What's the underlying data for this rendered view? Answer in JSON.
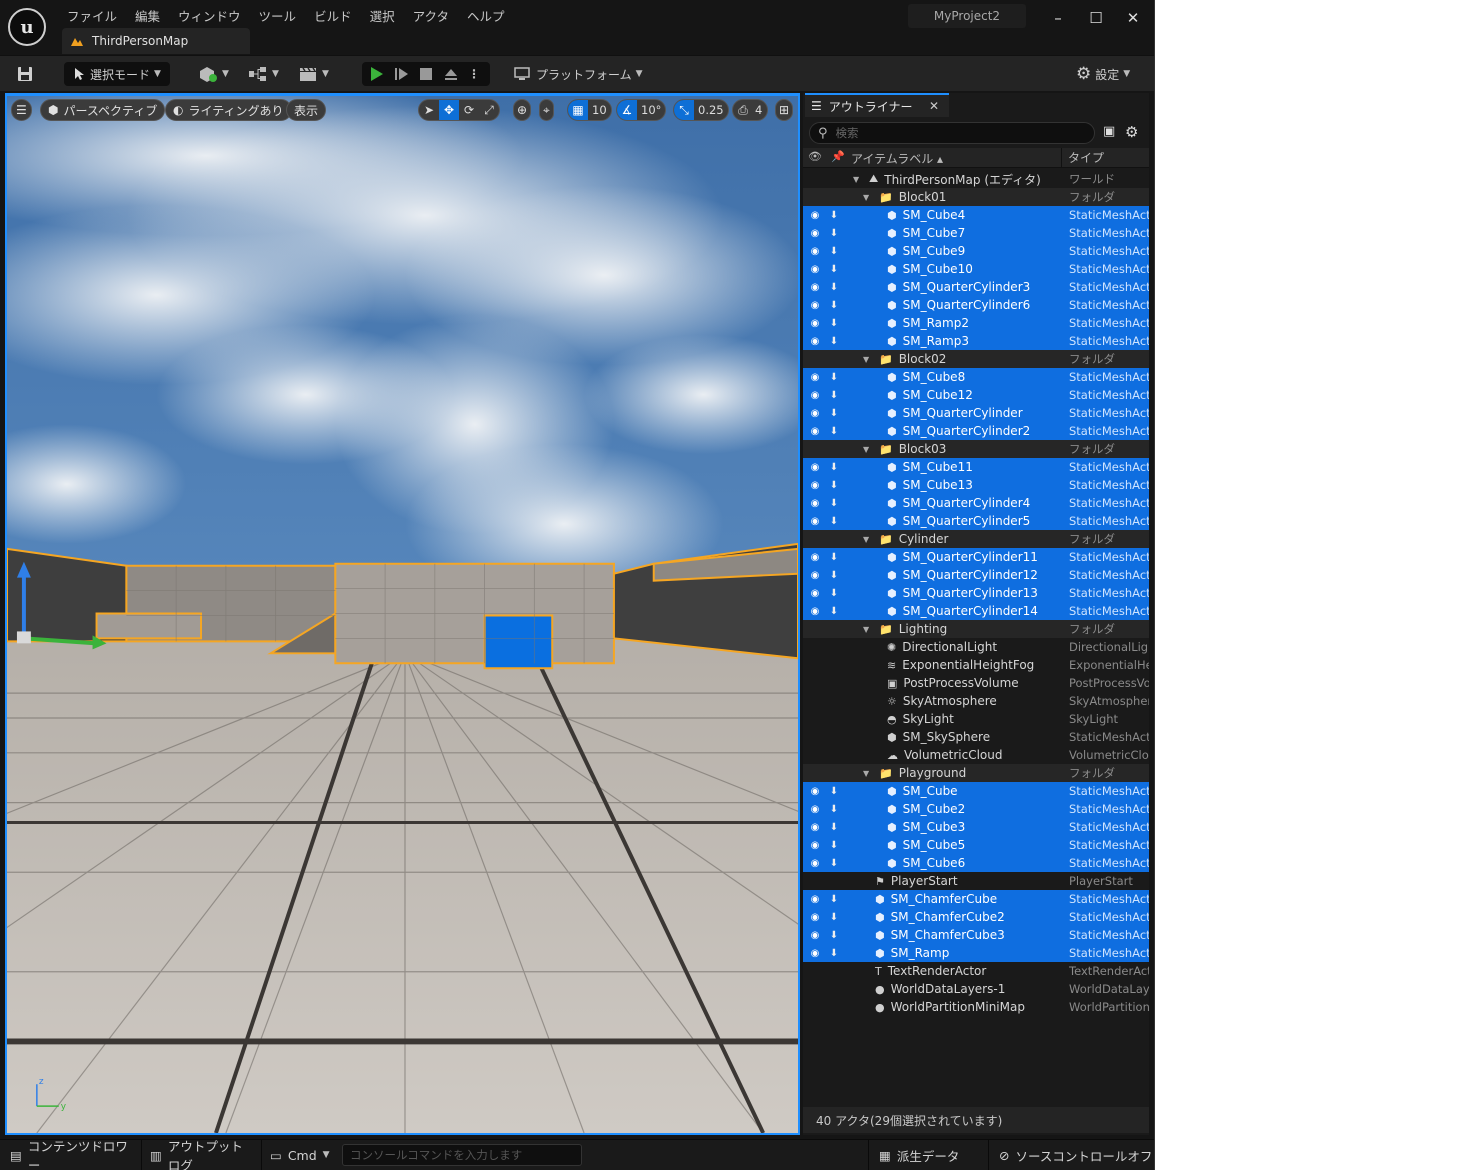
{
  "titlebar": {
    "menu": [
      "ファイル",
      "編集",
      "ウィンドウ",
      "ツール",
      "ビルド",
      "選択",
      "アクタ",
      "ヘルプ"
    ],
    "doc_tab": "ThirdPersonMap",
    "project": "MyProject2"
  },
  "toolbar": {
    "mode": "選択モード",
    "platform": "プラットフォーム",
    "settings": "設定"
  },
  "viewport": {
    "perspective": "パースペクティブ",
    "lighting": "ライティングあり",
    "show": "表示",
    "grid_snap": "10",
    "rot_snap": "10°",
    "scale_snap": "0.25",
    "camera_speed": "4"
  },
  "outliner": {
    "tab": "アウトライナー",
    "search_placeholder": "検索",
    "col_label": "アイテムラベル ▴",
    "col_type": "タイプ",
    "status": "40 アクタ(29個選択されています)",
    "rows": [
      {
        "label": "ThirdPersonMap (エディタ)",
        "type": "ワールド",
        "indent": 0,
        "kind": "world",
        "sel": false,
        "icon": "map-icon"
      },
      {
        "label": "Block01",
        "type": "フォルダ",
        "indent": 1,
        "kind": "folder",
        "sel": false,
        "icon": "folder-icon"
      },
      {
        "label": "SM_Cube4",
        "type": "StaticMeshActor",
        "indent": 2,
        "kind": "item",
        "sel": true,
        "icon": "static-mesh-icon"
      },
      {
        "label": "SM_Cube7",
        "type": "StaticMeshActor",
        "indent": 2,
        "kind": "item",
        "sel": true,
        "icon": "static-mesh-icon"
      },
      {
        "label": "SM_Cube9",
        "type": "StaticMeshActor",
        "indent": 2,
        "kind": "item",
        "sel": true,
        "icon": "static-mesh-icon"
      },
      {
        "label": "SM_Cube10",
        "type": "StaticMeshActor",
        "indent": 2,
        "kind": "item",
        "sel": true,
        "icon": "static-mesh-icon"
      },
      {
        "label": "SM_QuarterCylinder3",
        "type": "StaticMeshActor",
        "indent": 2,
        "kind": "item",
        "sel": true,
        "icon": "static-mesh-icon"
      },
      {
        "label": "SM_QuarterCylinder6",
        "type": "StaticMeshActor",
        "indent": 2,
        "kind": "item",
        "sel": true,
        "icon": "static-mesh-icon"
      },
      {
        "label": "SM_Ramp2",
        "type": "StaticMeshActor",
        "indent": 2,
        "kind": "item",
        "sel": true,
        "icon": "static-mesh-icon"
      },
      {
        "label": "SM_Ramp3",
        "type": "StaticMeshActor",
        "indent": 2,
        "kind": "item",
        "sel": true,
        "icon": "static-mesh-icon"
      },
      {
        "label": "Block02",
        "type": "フォルダ",
        "indent": 1,
        "kind": "folder",
        "sel": false,
        "icon": "folder-icon"
      },
      {
        "label": "SM_Cube8",
        "type": "StaticMeshActor",
        "indent": 2,
        "kind": "item",
        "sel": true,
        "icon": "static-mesh-icon"
      },
      {
        "label": "SM_Cube12",
        "type": "StaticMeshActor",
        "indent": 2,
        "kind": "item",
        "sel": true,
        "icon": "static-mesh-icon"
      },
      {
        "label": "SM_QuarterCylinder",
        "type": "StaticMeshActor",
        "indent": 2,
        "kind": "item",
        "sel": true,
        "icon": "static-mesh-icon"
      },
      {
        "label": "SM_QuarterCylinder2",
        "type": "StaticMeshActor",
        "indent": 2,
        "kind": "item",
        "sel": true,
        "icon": "static-mesh-icon"
      },
      {
        "label": "Block03",
        "type": "フォルダ",
        "indent": 1,
        "kind": "folder",
        "sel": false,
        "icon": "folder-icon"
      },
      {
        "label": "SM_Cube11",
        "type": "StaticMeshActor",
        "indent": 2,
        "kind": "item",
        "sel": true,
        "icon": "static-mesh-icon"
      },
      {
        "label": "SM_Cube13",
        "type": "StaticMeshActor",
        "indent": 2,
        "kind": "item",
        "sel": true,
        "icon": "static-mesh-icon"
      },
      {
        "label": "SM_QuarterCylinder4",
        "type": "StaticMeshActor",
        "indent": 2,
        "kind": "item",
        "sel": true,
        "icon": "static-mesh-icon"
      },
      {
        "label": "SM_QuarterCylinder5",
        "type": "StaticMeshActor",
        "indent": 2,
        "kind": "item",
        "sel": true,
        "icon": "static-mesh-icon"
      },
      {
        "label": "Cylinder",
        "type": "フォルダ",
        "indent": 1,
        "kind": "folder",
        "sel": false,
        "icon": "folder-icon"
      },
      {
        "label": "SM_QuarterCylinder11",
        "type": "StaticMeshActor",
        "indent": 2,
        "kind": "item",
        "sel": true,
        "icon": "static-mesh-icon"
      },
      {
        "label": "SM_QuarterCylinder12",
        "type": "StaticMeshActor",
        "indent": 2,
        "kind": "item",
        "sel": true,
        "icon": "static-mesh-icon"
      },
      {
        "label": "SM_QuarterCylinder13",
        "type": "StaticMeshActor",
        "indent": 2,
        "kind": "item",
        "sel": true,
        "icon": "static-mesh-icon"
      },
      {
        "label": "SM_QuarterCylinder14",
        "type": "StaticMeshActor",
        "indent": 2,
        "kind": "item",
        "sel": true,
        "icon": "static-mesh-icon"
      },
      {
        "label": "Lighting",
        "type": "フォルダ",
        "indent": 1,
        "kind": "folder",
        "sel": false,
        "icon": "folder-icon"
      },
      {
        "label": "DirectionalLight",
        "type": "DirectionalLight",
        "indent": 2,
        "kind": "item",
        "sel": false,
        "icon": "sun-icon"
      },
      {
        "label": "ExponentialHeightFog",
        "type": "ExponentialHeightFog",
        "indent": 2,
        "kind": "item",
        "sel": false,
        "icon": "fog-icon"
      },
      {
        "label": "PostProcessVolume",
        "type": "PostProcessVolume",
        "indent": 2,
        "kind": "item",
        "sel": false,
        "icon": "volume-icon"
      },
      {
        "label": "SkyAtmosphere",
        "type": "SkyAtmosphere",
        "indent": 2,
        "kind": "item",
        "sel": false,
        "icon": "atmosphere-icon"
      },
      {
        "label": "SkyLight",
        "type": "SkyLight",
        "indent": 2,
        "kind": "item",
        "sel": false,
        "icon": "skylight-icon"
      },
      {
        "label": "SM_SkySphere",
        "type": "StaticMeshActor",
        "indent": 2,
        "kind": "item",
        "sel": false,
        "icon": "static-mesh-icon"
      },
      {
        "label": "VolumetricCloud",
        "type": "VolumetricCloud",
        "indent": 2,
        "kind": "item",
        "sel": false,
        "icon": "cloud-icon"
      },
      {
        "label": "Playground",
        "type": "フォルダ",
        "indent": 1,
        "kind": "folder",
        "sel": false,
        "icon": "folder-icon"
      },
      {
        "label": "SM_Cube",
        "type": "StaticMeshActor",
        "indent": 2,
        "kind": "item",
        "sel": true,
        "icon": "static-mesh-icon"
      },
      {
        "label": "SM_Cube2",
        "type": "StaticMeshActor",
        "indent": 2,
        "kind": "item",
        "sel": true,
        "icon": "static-mesh-icon"
      },
      {
        "label": "SM_Cube3",
        "type": "StaticMeshActor",
        "indent": 2,
        "kind": "item",
        "sel": true,
        "icon": "static-mesh-icon"
      },
      {
        "label": "SM_Cube5",
        "type": "StaticMeshActor",
        "indent": 2,
        "kind": "item",
        "sel": true,
        "icon": "static-mesh-icon"
      },
      {
        "label": "SM_Cube6",
        "type": "StaticMeshActor",
        "indent": 2,
        "kind": "item",
        "sel": true,
        "icon": "static-mesh-icon"
      },
      {
        "label": "PlayerStart",
        "type": "PlayerStart",
        "indent": 1,
        "kind": "item",
        "sel": false,
        "icon": "player-start-icon"
      },
      {
        "label": "SM_ChamferCube",
        "type": "StaticMeshActor",
        "indent": 1,
        "kind": "item",
        "sel": true,
        "icon": "static-mesh-icon"
      },
      {
        "label": "SM_ChamferCube2",
        "type": "StaticMeshActor",
        "indent": 1,
        "kind": "item",
        "sel": true,
        "icon": "static-mesh-icon"
      },
      {
        "label": "SM_ChamferCube3",
        "type": "StaticMeshActor",
        "indent": 1,
        "kind": "item",
        "sel": true,
        "icon": "static-mesh-icon"
      },
      {
        "label": "SM_Ramp",
        "type": "StaticMeshActor",
        "indent": 1,
        "kind": "item",
        "sel": true,
        "icon": "static-mesh-icon"
      },
      {
        "label": "TextRenderActor",
        "type": "TextRenderActor",
        "indent": 1,
        "kind": "item",
        "sel": false,
        "icon": "text-render-icon"
      },
      {
        "label": "WorldDataLayers-1",
        "type": "WorldDataLayers",
        "indent": 1,
        "kind": "item",
        "sel": false,
        "icon": "world-data-icon"
      },
      {
        "label": "WorldPartitionMiniMap",
        "type": "WorldPartitionMiniMap",
        "indent": 1,
        "kind": "item",
        "sel": false,
        "icon": "world-data-icon"
      }
    ]
  },
  "bottombar": {
    "content_drawer": "コンテンツドロワー",
    "output_log": "アウトプットログ",
    "cmd": "Cmd",
    "console_placeholder": "コンソールコマンドを入力します",
    "derived_data": "派生データ",
    "source_control": "ソースコントロールオフ"
  },
  "colors": {
    "selection": "#0f6ee0",
    "accent_blue": "#1f8fff",
    "outline_orange": "#f5a623",
    "play_green": "#3bb33b"
  }
}
